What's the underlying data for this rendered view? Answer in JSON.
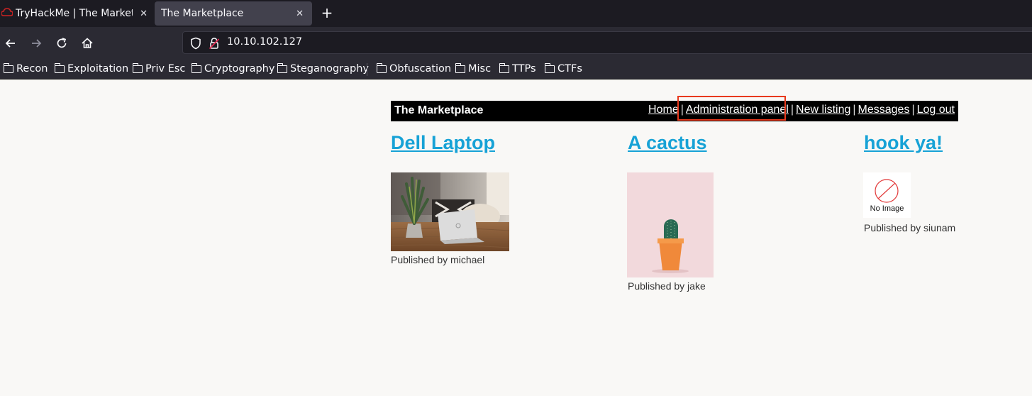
{
  "browser": {
    "tabs": [
      {
        "title": "TryHackMe | The Marketplace",
        "active": false
      },
      {
        "title": "The Marketplace",
        "active": true
      }
    ],
    "close_glyph": "✕",
    "new_tab_glyph": "+",
    "url": "10.10.102.127",
    "bookmarks": [
      "Recon",
      "Exploitation",
      "Priv Esc",
      "Cryptography",
      "Steganography",
      "Obfuscation",
      "Misc",
      "TTPs",
      "CTFs"
    ]
  },
  "site": {
    "title": "The Marketplace",
    "nav": [
      "Home",
      "Administration panel",
      "New listing",
      "Messages",
      "Log out"
    ],
    "separator": "|",
    "highlight_color": "#e8391d",
    "link_color": "#17a2d6",
    "listings": [
      {
        "title": "Dell Laptop",
        "published": "Published by michael"
      },
      {
        "title": "A cactus",
        "published": "Published by jake"
      },
      {
        "title": "hook ya!",
        "published": "Published by siunam",
        "image_placeholder": "No Image"
      }
    ]
  }
}
